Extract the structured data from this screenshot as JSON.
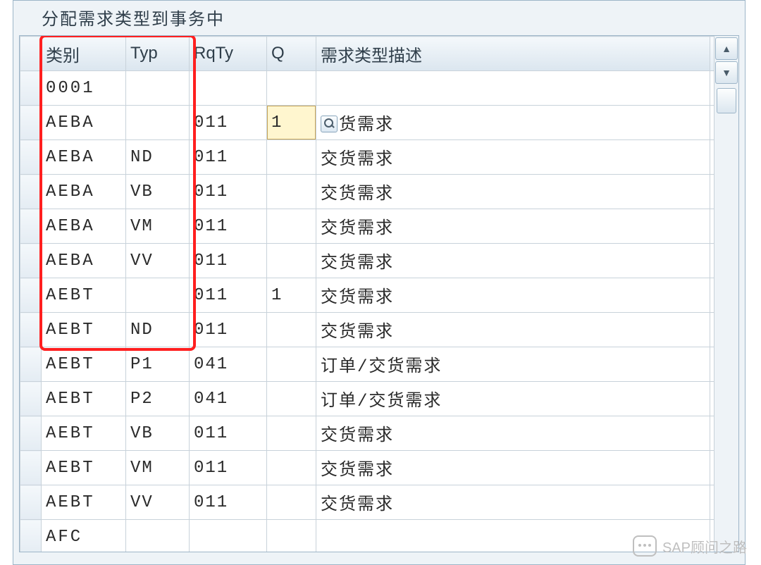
{
  "panel": {
    "title": "分配需求类型到事务中"
  },
  "columns": {
    "category": "类别",
    "typ": "Typ",
    "rqty": "RqTy",
    "q": "Q",
    "desc": "需求类型描述"
  },
  "rows": [
    {
      "category": "0001",
      "typ": "",
      "rqty": "",
      "q": "",
      "desc": "",
      "q_editable": false,
      "desc_has_search": false
    },
    {
      "category": "AEBA",
      "typ": "",
      "rqty": "011",
      "q": "1",
      "desc": "货需求",
      "q_editable": true,
      "desc_has_search": true
    },
    {
      "category": "AEBA",
      "typ": "ND",
      "rqty": "011",
      "q": "",
      "desc": "交货需求",
      "q_editable": false,
      "desc_has_search": false
    },
    {
      "category": "AEBA",
      "typ": "VB",
      "rqty": "011",
      "q": "",
      "desc": "交货需求",
      "q_editable": false,
      "desc_has_search": false
    },
    {
      "category": "AEBA",
      "typ": "VM",
      "rqty": "011",
      "q": "",
      "desc": "交货需求",
      "q_editable": false,
      "desc_has_search": false
    },
    {
      "category": "AEBA",
      "typ": "VV",
      "rqty": "011",
      "q": "",
      "desc": "交货需求",
      "q_editable": false,
      "desc_has_search": false
    },
    {
      "category": "AEBT",
      "typ": "",
      "rqty": "011",
      "q": "1",
      "desc": "交货需求",
      "q_editable": false,
      "desc_has_search": false
    },
    {
      "category": "AEBT",
      "typ": "ND",
      "rqty": "011",
      "q": "",
      "desc": "交货需求",
      "q_editable": false,
      "desc_has_search": false
    },
    {
      "category": "AEBT",
      "typ": "P1",
      "rqty": "041",
      "q": "",
      "desc": "订单/交货需求",
      "q_editable": false,
      "desc_has_search": false
    },
    {
      "category": "AEBT",
      "typ": "P2",
      "rqty": "041",
      "q": "",
      "desc": "订单/交货需求",
      "q_editable": false,
      "desc_has_search": false
    },
    {
      "category": "AEBT",
      "typ": "VB",
      "rqty": "011",
      "q": "",
      "desc": "交货需求",
      "q_editable": false,
      "desc_has_search": false
    },
    {
      "category": "AEBT",
      "typ": "VM",
      "rqty": "011",
      "q": "",
      "desc": "交货需求",
      "q_editable": false,
      "desc_has_search": false
    },
    {
      "category": "AEBT",
      "typ": "VV",
      "rqty": "011",
      "q": "",
      "desc": "交货需求",
      "q_editable": false,
      "desc_has_search": false
    },
    {
      "category": "AFC",
      "typ": "",
      "rqty": "",
      "q": "",
      "desc": "",
      "q_editable": false,
      "desc_has_search": false
    }
  ],
  "highlight": {
    "rows_covered": 8
  },
  "watermark": {
    "text": "SAP顾问之路"
  }
}
